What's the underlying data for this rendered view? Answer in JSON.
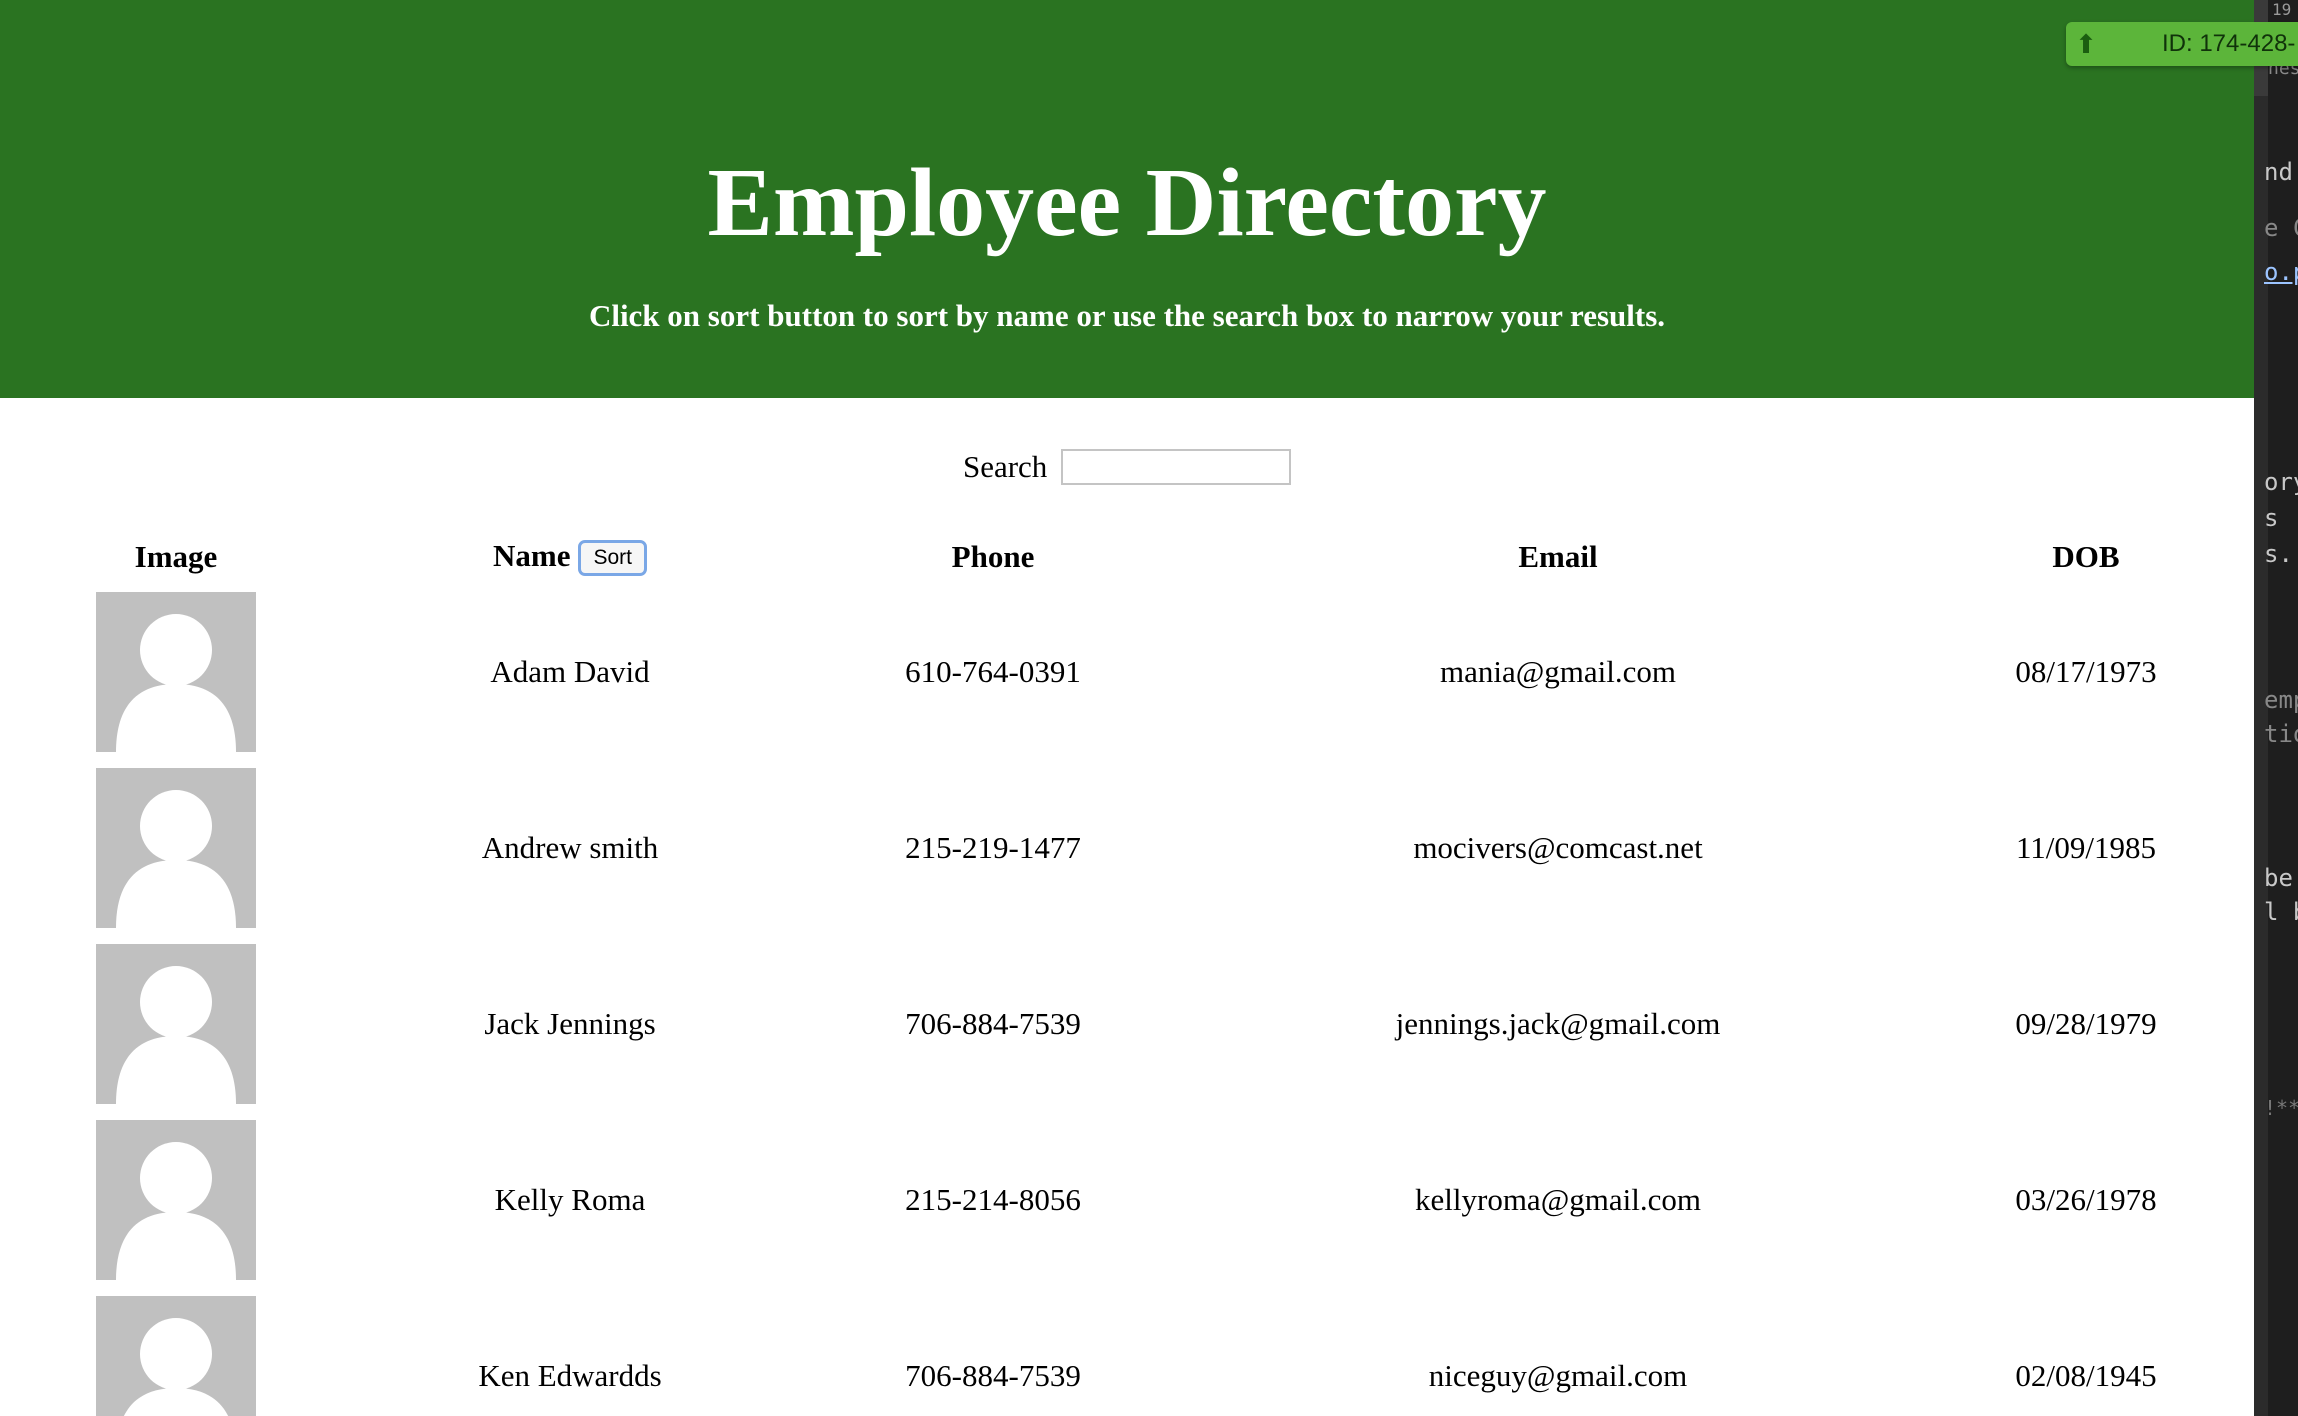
{
  "header": {
    "title": "Employee Directory",
    "subtitle": "Click on sort button to sort by name or use the search box to narrow your results."
  },
  "search": {
    "label": "Search",
    "value": "",
    "placeholder": ""
  },
  "table": {
    "columns": {
      "image": "Image",
      "name": "Name",
      "phone": "Phone",
      "email": "Email",
      "dob": "DOB"
    },
    "sort_label": "Sort",
    "rows": [
      {
        "name": "Adam David",
        "phone": "610-764-0391",
        "email": "mania@gmail.com",
        "dob": "08/17/1973"
      },
      {
        "name": "Andrew smith",
        "phone": "215-219-1477",
        "email": "mocivers@comcast.net",
        "dob": "11/09/1985"
      },
      {
        "name": "Jack Jennings",
        "phone": "706-884-7539",
        "email": "jennings.jack@gmail.com",
        "dob": "09/28/1979"
      },
      {
        "name": "Kelly Roma",
        "phone": "215-214-8056",
        "email": "kellyroma@gmail.com",
        "dob": "03/26/1978"
      },
      {
        "name": "Ken Edwardds",
        "phone": "706-884-7539",
        "email": "niceguy@gmail.com",
        "dob": "02/08/1945"
      }
    ]
  },
  "extension_badge": {
    "text": "ID: 174-428-"
  },
  "side_strip": {
    "top_text": "19",
    "lines": [
      "nes",
      "nd",
      "e C",
      "o.p",
      "ory",
      "s",
      "s.",
      "emp",
      "tio",
      "be",
      "l b",
      "!**"
    ]
  },
  "colors": {
    "header_bg": "#2a7321",
    "header_text": "#ffffff",
    "badge_bg": "#5cb53a",
    "avatar_bg": "#c0c0c0"
  },
  "icons": {
    "avatar": "default-user-avatar-icon",
    "badge_arrow": "up-arrow-icon"
  }
}
